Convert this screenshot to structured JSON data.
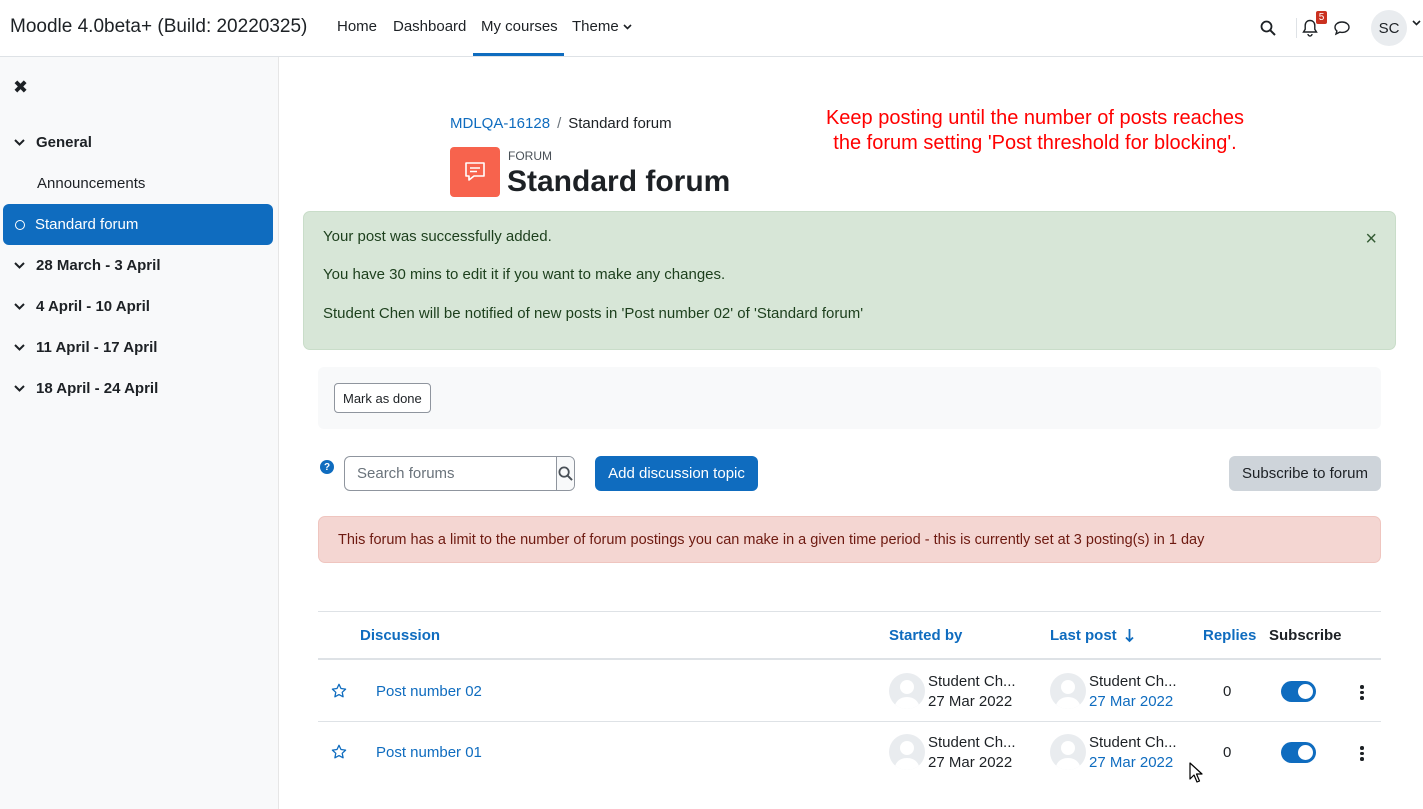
{
  "navbar": {
    "brand": "Moodle 4.0beta+ (Build: 20220325)",
    "links": [
      "Home",
      "Dashboard",
      "My courses",
      "Theme"
    ],
    "active_link": "My courses",
    "notification_count": "5",
    "user_initials": "SC",
    "icons": [
      "search-icon",
      "bell-icon",
      "chat-icon",
      "chevron-down-icon"
    ]
  },
  "sidebar": {
    "close_icon": "close-icon",
    "sections": [
      {
        "label": "General",
        "items": [
          "Announcements",
          "Standard forum"
        ]
      },
      {
        "label": "28 March - 3 April"
      },
      {
        "label": "4 April - 10 April"
      },
      {
        "label": "11 April - 17 April"
      },
      {
        "label": "18 April - 24 April"
      }
    ],
    "active_item": "Standard forum"
  },
  "breadcrumb": {
    "course": "MDLQA-16128",
    "current": "Standard forum"
  },
  "header": {
    "small_label": "FORUM",
    "title": "Standard forum"
  },
  "annotation": {
    "line1": "Keep posting until the number of posts reaches",
    "line2": "the forum setting 'Post threshold for blocking'."
  },
  "success_alert": {
    "line1": "Your post was successfully added.",
    "line2": "You have 30 mins to edit it if you want to make any changes.",
    "line3": "Student Chen will be notified of new posts in 'Post number 02' of 'Standard forum'",
    "close": "×"
  },
  "mark_done_label": "Mark as done",
  "search": {
    "placeholder": "Search forums",
    "value": ""
  },
  "add_topic_label": "Add discussion topic",
  "subscribe_label": "Subscribe to forum",
  "limit_alert": "This forum has a limit to the number of forum postings you can make in a given time period - this is currently set at 3 posting(s) in 1 day",
  "table": {
    "headers": {
      "discussion": "Discussion",
      "started_by": "Started by",
      "last_post": "Last post",
      "replies": "Replies",
      "subscribe": "Subscribe"
    },
    "rows": [
      {
        "title": "Post number 02",
        "started_name": "Student Ch...",
        "started_date": "27 Mar 2022",
        "last_name": "Student Ch...",
        "last_date": "27 Mar 2022",
        "replies": "0",
        "subscribed": true
      },
      {
        "title": "Post number 01",
        "started_name": "Student Ch...",
        "started_date": "27 Mar 2022",
        "last_name": "Student Ch...",
        "last_date": "27 Mar 2022",
        "replies": "0",
        "subscribed": true
      }
    ]
  },
  "colors": {
    "primary": "#0f6cbf",
    "forum_icon": "#f7634d",
    "success_bg": "#d7e6d7",
    "danger_bg": "#f4d6d2",
    "annotation": "#ff0000"
  }
}
